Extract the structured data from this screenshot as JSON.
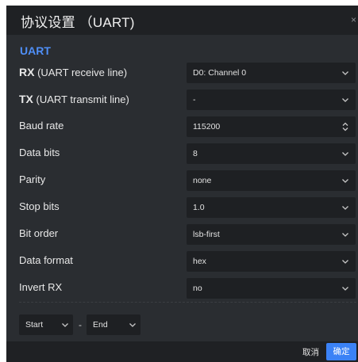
{
  "dialog": {
    "title": "协议设置 （UART)",
    "close_label": "×"
  },
  "section": {
    "title": "UART"
  },
  "fields": [
    {
      "key": "RX",
      "desc": "(UART receive line)",
      "value": "D0: Channel 0",
      "control": "select"
    },
    {
      "key": "TX",
      "desc": "(UART transmit line)",
      "value": "-",
      "control": "select"
    },
    {
      "key": "",
      "desc": "Baud rate",
      "value": "115200",
      "control": "spinner"
    },
    {
      "key": "",
      "desc": "Data bits",
      "value": "8",
      "control": "select"
    },
    {
      "key": "",
      "desc": "Parity",
      "value": "none",
      "control": "select"
    },
    {
      "key": "",
      "desc": "Stop bits",
      "value": "1.0",
      "control": "select"
    },
    {
      "key": "",
      "desc": "Bit order",
      "value": "lsb-first",
      "control": "select"
    },
    {
      "key": "",
      "desc": "Data format",
      "value": "hex",
      "control": "select"
    },
    {
      "key": "",
      "desc": "Invert RX",
      "value": "no",
      "control": "select"
    }
  ],
  "range": {
    "start_label": "Start",
    "separator": "-",
    "end_label": "End"
  },
  "footer": {
    "cancel_label": "取消",
    "ok_label": "确定"
  },
  "colors": {
    "accent": "#3b82f6",
    "section_title": "#4f8ff7",
    "dialog_bg": "#2a2d31",
    "control_bg": "#1e2023"
  }
}
